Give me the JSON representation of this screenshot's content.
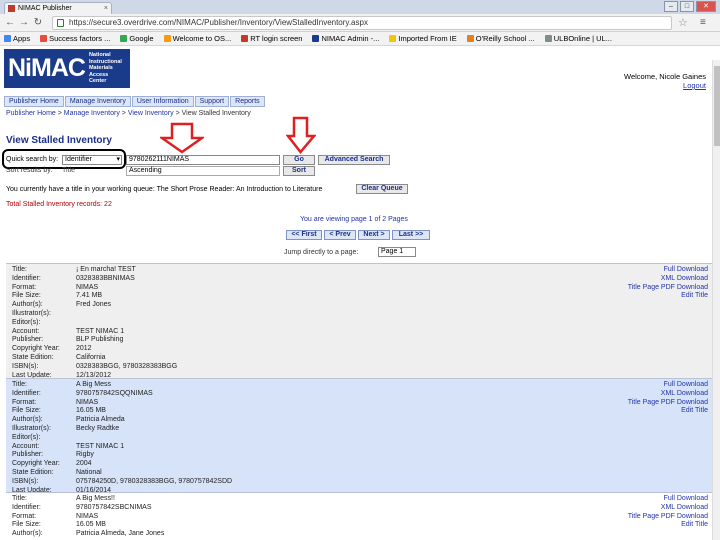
{
  "browser": {
    "tab_title": "NIMAC Publisher",
    "tab_close": "×",
    "url": "https://secure3.overdrive.com/NIMAC/Publisher/Inventory/ViewStalledInventory.aspx",
    "bookmarks": [
      {
        "label": "Apps",
        "color": "#4285f4"
      },
      {
        "label": "Success factors ...",
        "color": "#e74c3c"
      },
      {
        "label": "Google",
        "color": "#34a853"
      },
      {
        "label": "Welcome to OS...",
        "color": "#f39c12"
      },
      {
        "label": "RT login screen",
        "color": "#c0392b"
      },
      {
        "label": "NIMAC Admin -...",
        "color": "#1a3a8a"
      },
      {
        "label": "Imported From IE",
        "color": "#f1c40f"
      },
      {
        "label": "O'Reilly School ...",
        "color": "#e67e22"
      },
      {
        "label": "ULBOnline | UL...",
        "color": "#7f8c8d"
      }
    ]
  },
  "header": {
    "logo_text": "NiMAC",
    "logo_sub": [
      "National",
      "Instructional",
      "Materials",
      "Access",
      "Center"
    ],
    "welcome": "Welcome, Nicole Gaines",
    "logout": "Logout"
  },
  "menu": [
    "Publisher Home",
    "Manage Inventory",
    "User Information",
    "Support",
    "Reports"
  ],
  "breadcrumb": [
    "Publisher Home",
    "Manage Inventory",
    "View Inventory",
    "View Stalled Inventory"
  ],
  "page_title": "View Stalled Inventory",
  "search": {
    "label": "Quick search by:",
    "field": "Identifier",
    "value": "9780262111NIMAS",
    "go": "Go",
    "advanced": "Advanced Search",
    "sort_label": "Sort results by:",
    "sort_field": "Title",
    "sort_order": "Ascending",
    "sort_button": "Sort"
  },
  "queue": {
    "text": "You currently have a title in your working queue: The Short Prose Reader: An Introduction to Literature",
    "button": "Clear Queue"
  },
  "total": "Total Stalled Inventory records: 22",
  "viewing": "You are viewing page 1 of 2 Pages",
  "pager": [
    "<< First",
    "< Prev",
    "Next >",
    "Last >>"
  ],
  "jump_label": "Jump directly to a page:",
  "jump_value": "Page 1",
  "downloads": [
    "Full Download",
    "XML Download",
    "Title Page PDF Download",
    "Edit Title"
  ],
  "records": [
    {
      "fields": [
        {
          "k": "Title:",
          "v": "¡ En marcha! TEST"
        },
        {
          "k": "Identifier:",
          "v": "0328383BBNIMAS"
        },
        {
          "k": "Format:",
          "v": "NIMAS"
        },
        {
          "k": "File Size:",
          "v": "7.41 MB"
        },
        {
          "k": "Author(s):",
          "v": "Fred Jones"
        },
        {
          "k": "Illustrator(s):",
          "v": ""
        },
        {
          "k": "Editor(s):",
          "v": ""
        },
        {
          "k": "Account:",
          "v": "TEST NIMAC 1"
        },
        {
          "k": "Publisher:",
          "v": "BLP Publishing"
        },
        {
          "k": "Copyright Year:",
          "v": "2012"
        },
        {
          "k": "State Edition:",
          "v": "California"
        },
        {
          "k": "ISBN(s):",
          "v": "0328383BGG, 9780328383BGG"
        },
        {
          "k": "Last Update:",
          "v": "12/13/2012"
        }
      ]
    },
    {
      "fields": [
        {
          "k": "Title:",
          "v": "A Big Mess"
        },
        {
          "k": "Identifier:",
          "v": "9780757842SQQNIMAS"
        },
        {
          "k": "Format:",
          "v": "NIMAS"
        },
        {
          "k": "File Size:",
          "v": "16.05 MB"
        },
        {
          "k": "Author(s):",
          "v": "Patricia Almeda"
        },
        {
          "k": "Illustrator(s):",
          "v": "Becky Radtke"
        },
        {
          "k": "Editor(s):",
          "v": ""
        },
        {
          "k": "Account:",
          "v": "TEST NIMAC 1"
        },
        {
          "k": "Publisher:",
          "v": "Rigby"
        },
        {
          "k": "Copyright Year:",
          "v": "2004"
        },
        {
          "k": "State Edition:",
          "v": "National"
        },
        {
          "k": "ISBN(s):",
          "v": "075784250D, 9780328383BGG, 9780757842SDD"
        },
        {
          "k": "Last Update:",
          "v": "01/16/2014"
        }
      ]
    },
    {
      "fields": [
        {
          "k": "Title:",
          "v": "A Big Mess!!"
        },
        {
          "k": "Identifier:",
          "v": "9780757842SBCNIMAS"
        },
        {
          "k": "Format:",
          "v": "NIMAS"
        },
        {
          "k": "File Size:",
          "v": "16.05 MB"
        },
        {
          "k": "Author(s):",
          "v": "Patricia Almeda, Jane Jones"
        }
      ]
    }
  ]
}
